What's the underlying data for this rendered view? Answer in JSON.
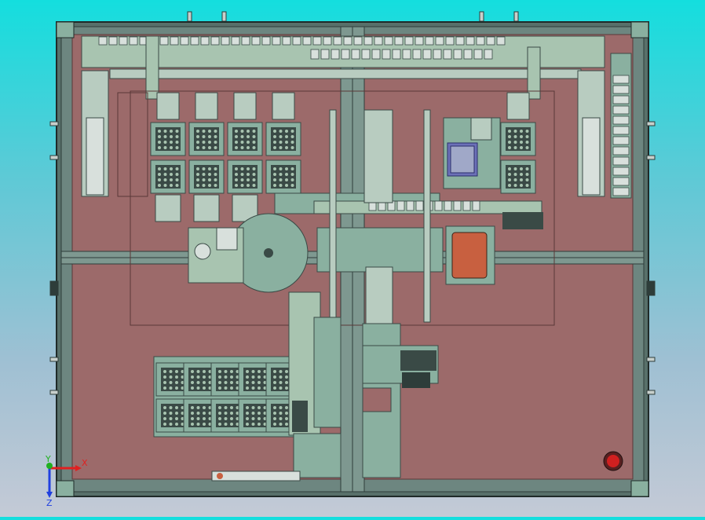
{
  "viewport": {
    "background_top": "#14dede",
    "background_bottom": "#c4cad6"
  },
  "triad": {
    "x_label": "X",
    "y_label": "Y",
    "z_label": "Z",
    "x_color": "#e02020",
    "y_color": "#20b020",
    "z_color": "#2040e0"
  },
  "colors": {
    "frame": "#58706a",
    "frame_dark": "#2e3d3a",
    "plate": "#9c6a6a",
    "plate_line": "#6e4848",
    "module": "#8ab0a0",
    "module_dark": "#3a4a46",
    "rail": "#a8c4b0",
    "tray_orange": "#c86040",
    "stop_button": "#d02020"
  },
  "icons": {
    "triad": "axis-triad-icon",
    "stop": "emergency-stop-icon"
  }
}
